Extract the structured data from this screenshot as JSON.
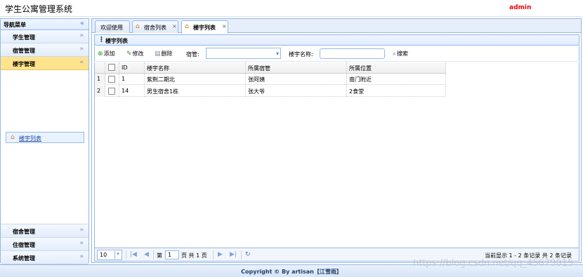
{
  "header": {
    "title": "学生公寓管理系统",
    "user": "admin"
  },
  "sidebar": {
    "title": "导航菜单",
    "sections_top": [
      {
        "label": "学生管理",
        "arrow": "»"
      },
      {
        "label": "宿管管理",
        "arrow": "»"
      },
      {
        "label": "楼宇管理",
        "arrow": "«"
      }
    ],
    "active_item": "楼宇列表",
    "sections_bottom": [
      {
        "label": "宿舍管理",
        "arrow": "»"
      },
      {
        "label": "住宿管理",
        "arrow": "»"
      },
      {
        "label": "系统管理",
        "arrow": "»"
      }
    ]
  },
  "tabs": [
    {
      "label": "欢迎使用"
    },
    {
      "label": "宿舍列表"
    },
    {
      "label": "楼宇列表"
    }
  ],
  "panel": {
    "title": "楼宇列表"
  },
  "toolbar": {
    "add": "添加",
    "edit": "修改",
    "delete": "删除",
    "manager_label": "宿管:",
    "name_label": "楼宇名称:",
    "search": "搜索"
  },
  "table": {
    "headers": [
      "ID",
      "楼宇名称",
      "所属宿管",
      "所属位置"
    ],
    "rows": [
      {
        "num": "1",
        "id": "1",
        "name": "紫荆二期北",
        "manager": "张阿姨",
        "location": "南门附近"
      },
      {
        "num": "2",
        "id": "14",
        "name": "男生宿舍1栋",
        "manager": "张大爷",
        "location": "2食堂"
      }
    ]
  },
  "pager": {
    "page_size": "10",
    "page_prefix": "第",
    "page_value": "1",
    "page_suffix": "页 共 1 页",
    "summary": "当前显示 1 - 2 条记录 共 2 条记录"
  },
  "footer": "Copyright © By artisan【江雪雨】",
  "watermark": "https://blog.csdn.net/qq_45679015",
  "colors": {
    "accent_border": "#95b8e7",
    "active_section": "#ffe48d",
    "user": "#ee0000"
  }
}
